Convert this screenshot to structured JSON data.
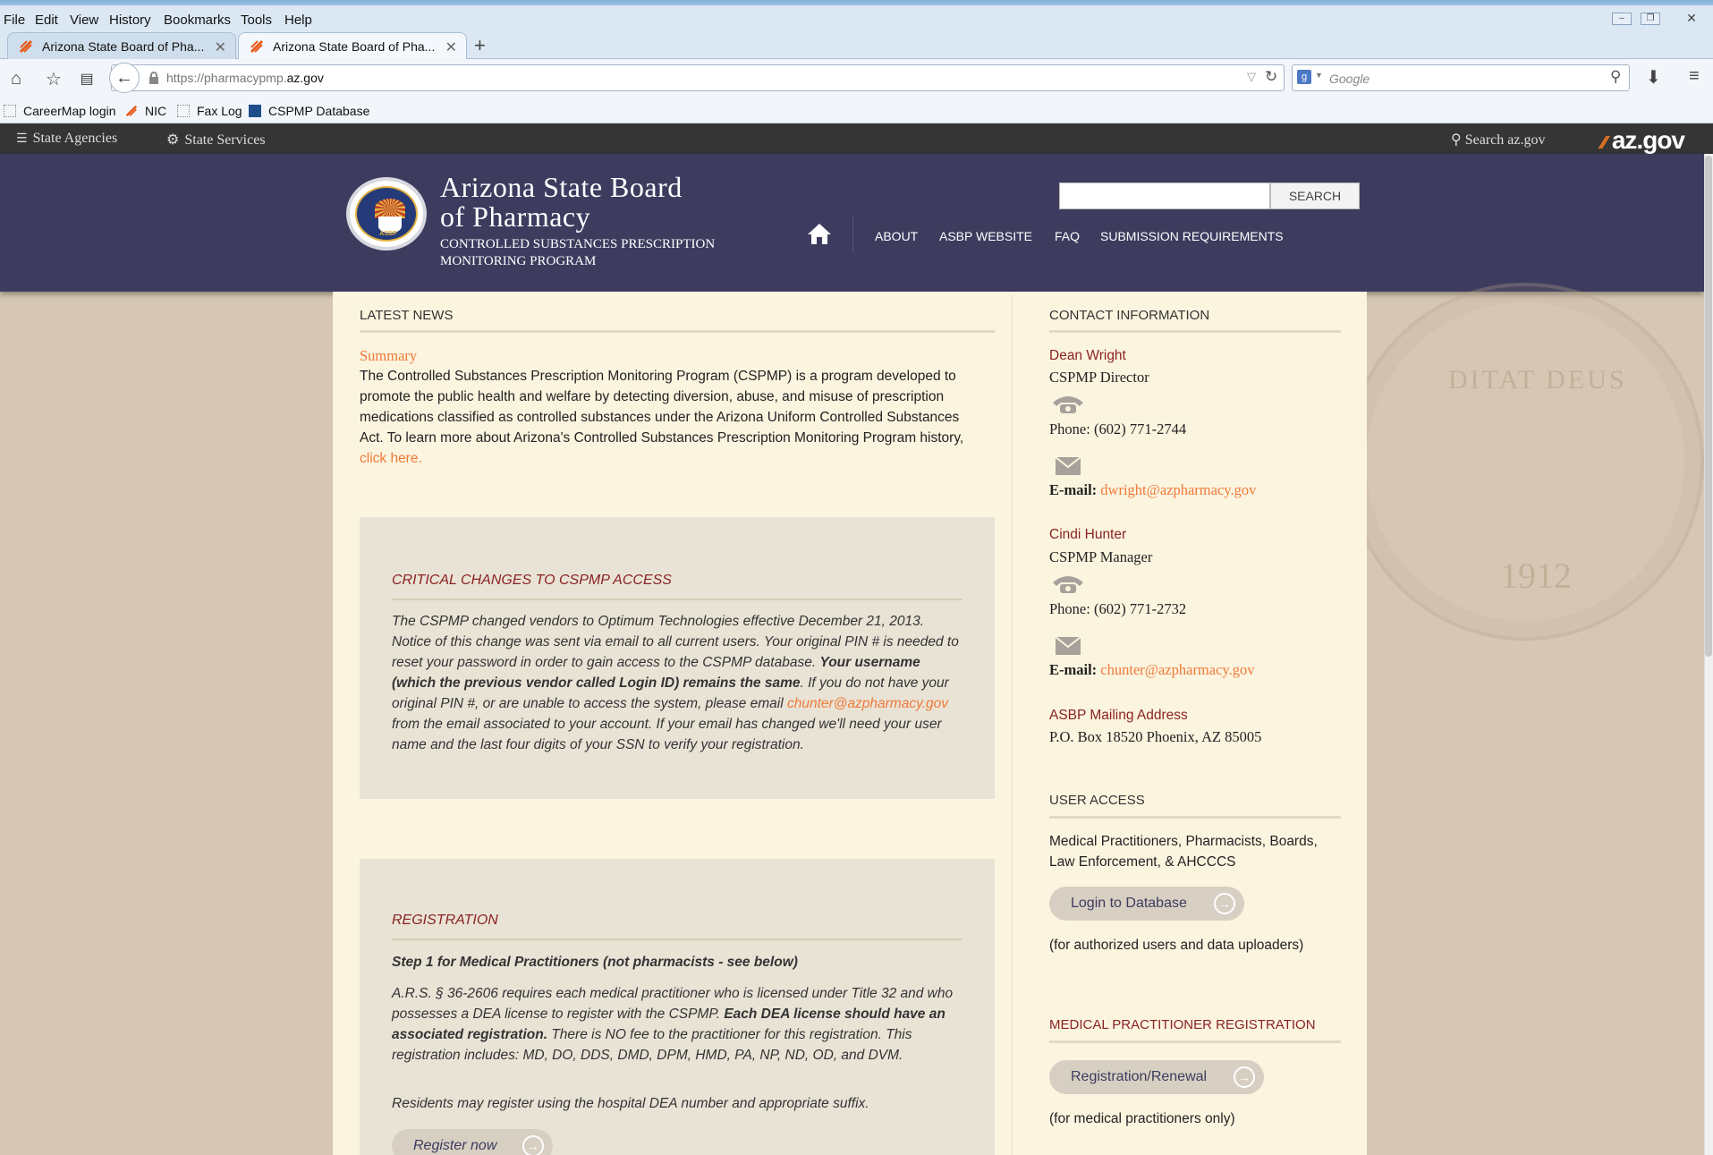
{
  "browser": {
    "menu": [
      "File",
      "Edit",
      "View",
      "History",
      "Bookmarks",
      "Tools",
      "Help"
    ],
    "tabs": [
      {
        "title": "Arizona State Board of Pha...",
        "active": false
      },
      {
        "title": "Arizona State Board of Pha...",
        "active": true
      }
    ],
    "url_prefix": "https://pharmacypmp.",
    "url_domain": "az.gov",
    "search_placeholder": "Google",
    "bookmarks": [
      "CareerMap login",
      "NIC",
      "Fax Log",
      "CSPMP Database"
    ]
  },
  "azbar": {
    "state_agencies": "State Agencies",
    "state_services": "State Services",
    "search": "Search az.gov",
    "logo_main": "az",
    "logo_suffix": ".gov"
  },
  "header": {
    "seal_text": "ASBP",
    "title_line1": "Arizona State Board",
    "title_line2": "of Pharmacy",
    "subtitle": "CONTROLLED SUBSTANCES PRESCRIPTION MONITORING PROGRAM",
    "search_button": "SEARCH",
    "nav": [
      "ABOUT",
      "ASBP WEBSITE",
      "FAQ",
      "SUBMISSION REQUIREMENTS"
    ]
  },
  "watermark": {
    "motto": "DITAT DEUS",
    "year": "1912"
  },
  "main": {
    "latest_news": "LATEST NEWS",
    "summary_heading": "Summary",
    "summary_text": "The Controlled Substances Prescription Monitoring Program (CSPMP) is a program developed to promote the public health and welfare by detecting diversion, abuse, and misuse of prescription medications classified as controlled substances under the Arizona Uniform Controlled Substances Act. To learn more about Arizona's Controlled Substances Prescription Monitoring Program history, ",
    "summary_link": "click here.",
    "critical": {
      "title": "CRITICAL CHANGES TO CSPMP ACCESS",
      "p1": "The CSPMP changed vendors to Optimum Technologies effective December 21, 2013. Notice of this change was sent via email to all current users. Your original PIN # is needed to reset your password in order to gain access to the CSPMP database. ",
      "bold": "Your username (which the previous vendor called Login ID) remains the same",
      "p2": ". If you do not have your original PIN #, or are unable to access the system, please email ",
      "email": "chunter@azpharmacy.gov",
      "p3": " from the email associated to your account. If your email has changed we'll need your user name and the last four digits of your SSN to verify your registration."
    },
    "registration": {
      "title": "REGISTRATION",
      "step1": "Step 1 for Medical Practitioners (not pharmacists - see below)",
      "p1": "A.R.S. § 36-2606 requires each medical practitioner who is licensed under Title 32 and who possesses a DEA license to register with the CSPMP.  ",
      "bold": "Each DEA license should have an associated registration.",
      "p2": "  There is NO fee to the practitioner for this registration. This registration includes: MD, DO, DDS, DMD, DPM, HMD, PA, NP, ND, OD, and DVM.",
      "p3": "Residents may register using the hospital DEA number and appropriate suffix.",
      "button": "Register now"
    }
  },
  "sidebar": {
    "contact_heading": "CONTACT INFORMATION",
    "contacts": [
      {
        "name": "Dean Wright",
        "role": "CSPMP Director",
        "phone": "Phone: (602) 771-2744",
        "email_label": "E-mail: ",
        "email": "dwright@azpharmacy.gov"
      },
      {
        "name": "Cindi Hunter",
        "role": "CSPMP Manager",
        "phone": "Phone: (602) 771-2732",
        "email_label": "E-mail: ",
        "email": "chunter@azpharmacy.gov"
      }
    ],
    "mailing_heading": "ASBP Mailing Address",
    "mailing_address": "P.O. Box 18520 Phoenix, AZ 85005",
    "user_access_heading": "USER ACCESS",
    "user_access_text": "Medical Practitioners, Pharmacists, Boards, Law Enforcement, & AHCCCS",
    "login_button": "Login to Database",
    "login_note": "(for authorized users and data uploaders)",
    "mp_heading": "MEDICAL PRACTITIONER REGISTRATION",
    "mp_button": "Registration/Renewal",
    "mp_note": "(for medical practitioners only)"
  },
  "colors": {
    "header_bg": "#3d3c5f",
    "accent_orange": "#f07a3a",
    "dark_red": "#8a2323",
    "page_bg": "#d6c7b4",
    "content_bg": "#fbf4df"
  }
}
